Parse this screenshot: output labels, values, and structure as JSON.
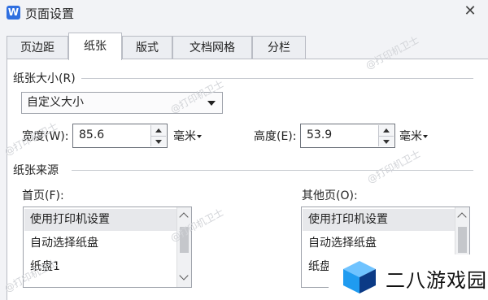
{
  "window": {
    "app_icon_letter": "W",
    "title": "页面设置",
    "close_glyph": "✕"
  },
  "tabs": [
    {
      "label": "页边距",
      "active": false
    },
    {
      "label": "纸张",
      "active": true
    },
    {
      "label": "版式",
      "active": false
    },
    {
      "label": "文档网格",
      "active": false
    },
    {
      "label": "分栏",
      "active": false
    }
  ],
  "paper_size": {
    "section_label": "纸张大小(R)",
    "selected": "自定义大小",
    "width_label": "宽度(W):",
    "width_value": "85.6",
    "height_label": "高度(E):",
    "height_value": "53.9",
    "unit": "毫米"
  },
  "paper_source": {
    "section_label": "纸张来源",
    "first_page_label": "首页(F):",
    "other_pages_label": "其他页(O):",
    "first_page_items": [
      "使用打印机设置",
      "自动选择纸盘",
      "纸盘1"
    ],
    "other_pages_items": [
      "使用打印机设置",
      "自动选择纸盘",
      "纸盘1"
    ],
    "selected_index": 0
  },
  "watermark_text": "@打印机卫士",
  "brand": {
    "text": "二八游戏园",
    "colors": {
      "left": "#1f9bf0",
      "right": "#0b3a86",
      "top": "#6fc3ff"
    }
  },
  "colors": {
    "background": "#f2f3f6",
    "panel": "#ffffff",
    "accent": "#2f6fe0",
    "selected_item": "#e7e8eb"
  }
}
